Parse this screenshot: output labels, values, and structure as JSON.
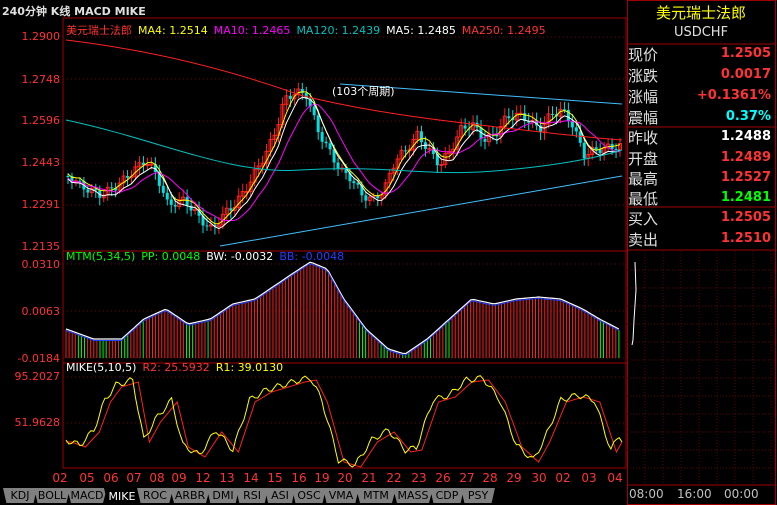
{
  "window": {
    "title": "240分钟 K线 MACD MIKE"
  },
  "colors": {
    "axis_red": "#ff3333",
    "grid_red": "#a00000",
    "up_candle": "#ff2020",
    "down_candle": "#00e0e0",
    "ma4": "#ffff00",
    "ma10": "#ff00ff",
    "ma120": "#00c0c0",
    "ma5": "#ffffff",
    "ma250": "#ff2020",
    "trendline": "#40c0ff",
    "positive_value": "#ff3333",
    "negative_value": "#00ff00",
    "neutral_value": "#ffffff",
    "change_pct_value": "#00ffff"
  },
  "main_panel": {
    "legend": {
      "name": "美元瑞士法郎",
      "ma4": "MA4: 1.2514",
      "ma10": "MA10: 1.2465",
      "ma120": "MA120: 1.2439",
      "ma5": "MA5: 1.2485",
      "ma250": "MA250: 1.2495"
    },
    "y_ticks": [
      "1.2900",
      "1.2748",
      "1.2596",
      "1.2443",
      "1.2291",
      "1.2135"
    ],
    "annotation": "(103个周期)"
  },
  "mtm_panel": {
    "legend": {
      "mtm": "MTM(5,34,5)",
      "pp": "PP: 0.0048",
      "bw": "BW: -0.0032",
      "bb": "BB: -0.0048"
    },
    "y_ticks": [
      "0.0310",
      "0.0063",
      "-0.0184"
    ]
  },
  "mike_panel": {
    "legend": {
      "mike": "MIKE(5,10,5)",
      "r2": "R2: 25.5932",
      "r1": "R1: 39.0130"
    },
    "y_ticks": [
      "95.2027",
      "51.9628"
    ]
  },
  "x_axis": {
    "ticks": [
      "02",
      "05",
      "06",
      "07",
      "08",
      "09",
      "12",
      "13",
      "14",
      "15",
      "16",
      "19",
      "20",
      "21",
      "22",
      "23",
      "26",
      "27",
      "28",
      "29",
      "30",
      "02",
      "03",
      "04"
    ]
  },
  "tabs": [
    "KDJ",
    "BOLL",
    "MACD",
    "MIKE",
    "ROC",
    "ARBR",
    "DMI",
    "RSI",
    "ASI",
    "OSC",
    "VMA",
    "MTM",
    "MASS",
    "CDP",
    "PSY"
  ],
  "active_tab": "MIKE",
  "quote": {
    "name": "美元瑞士法郎",
    "symbol": "USDCHF",
    "rows": [
      {
        "label": "现价",
        "value": "1.2505",
        "color": "#ff3333"
      },
      {
        "label": "涨跌",
        "value": "0.0017",
        "color": "#ff3333"
      },
      {
        "label": "涨幅",
        "value": "+0.1361%",
        "color": "#ff3333"
      },
      {
        "label": "震幅",
        "value": "0.37%",
        "color": "#00ffff"
      },
      {
        "label": "昨收",
        "value": "1.2488",
        "color": "#ffffff"
      },
      {
        "label": "开盘",
        "value": "1.2489",
        "color": "#ff3333"
      },
      {
        "label": "最高",
        "value": "1.2527",
        "color": "#ff3333"
      },
      {
        "label": "最低",
        "value": "1.2481",
        "color": "#00ff00"
      },
      {
        "label": "买入",
        "value": "1.2505",
        "color": "#ff3333"
      },
      {
        "label": "卖出",
        "value": "1.2510",
        "color": "#ff3333"
      }
    ],
    "time_labels": [
      "08:00",
      "16:00",
      "00:00"
    ]
  }
}
